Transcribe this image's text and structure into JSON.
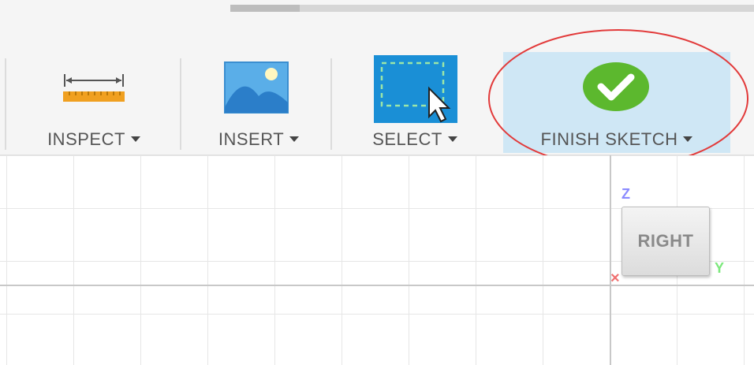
{
  "toolbar": {
    "groups": [
      {
        "label": "INSPECT",
        "icon": "ruler-icon"
      },
      {
        "label": "INSERT",
        "icon": "image-icon"
      },
      {
        "label": "SELECT",
        "icon": "selection-box-icon"
      },
      {
        "label": "FINISH SKETCH",
        "icon": "checkmark-icon",
        "active": true
      }
    ],
    "active_color": "#cfe7f5",
    "finish_icon_color": "#5cb82e",
    "select_icon_color": "#1a8fd6",
    "highlight_color": "#e23a3a"
  },
  "viewcube": {
    "face_label": "RIGHT",
    "axis_z": "Z",
    "axis_y": "Y",
    "axis_x": "×"
  }
}
